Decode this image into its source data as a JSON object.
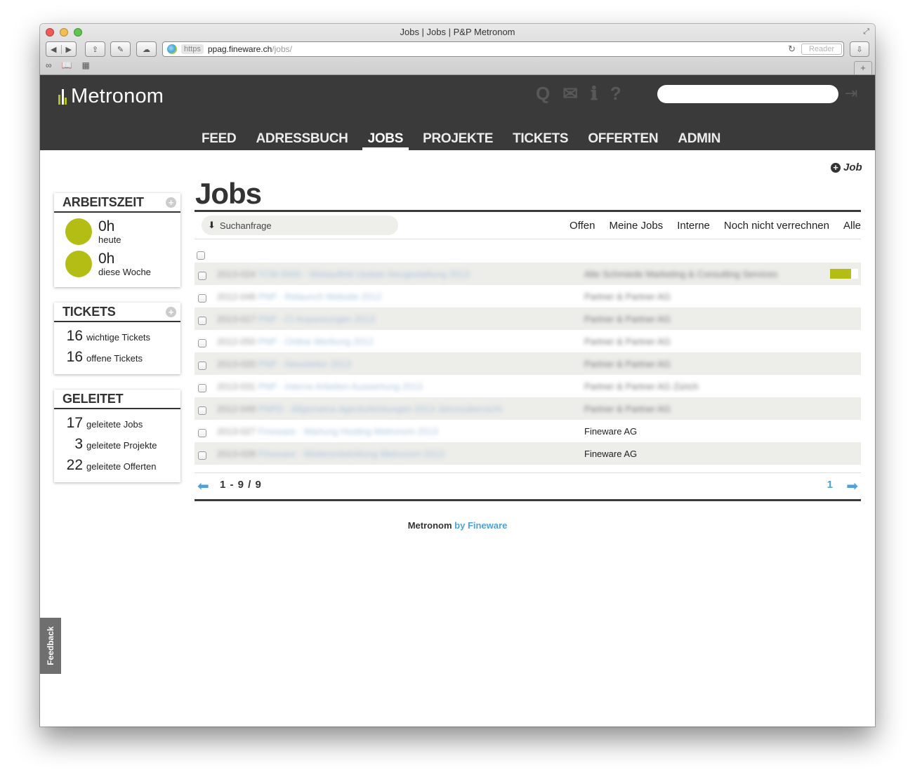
{
  "browser": {
    "title": "Jobs | Jobs | P&P Metronom",
    "url_scheme": "https",
    "url_host": "ppag.fineware.ch",
    "url_path": "/jobs/",
    "reader_label": "Reader",
    "nav_back_icon": "◀",
    "nav_forward_icon": "▶",
    "share_icon": "⇪",
    "tools_icon": "✎",
    "cloud_icon": "☁",
    "reload_icon": "↻",
    "download_icon": "⇩",
    "bookmark_icons": [
      "∞",
      "📖",
      "▦"
    ],
    "newtab_icon": "+"
  },
  "app": {
    "logo_text": "Metronom",
    "header_icons": [
      "Q",
      "✉",
      "ℹ",
      "?"
    ],
    "search_placeholder": "",
    "logout_icon": "⇥",
    "nav": [
      {
        "label": "FEED",
        "active": false
      },
      {
        "label": "ADRESSBUCH",
        "active": false
      },
      {
        "label": "JOBS",
        "active": true
      },
      {
        "label": "PROJEKTE",
        "active": false
      },
      {
        "label": "TICKETS",
        "active": false
      },
      {
        "label": "OFFERTEN",
        "active": false
      },
      {
        "label": "ADMIN",
        "active": false
      }
    ]
  },
  "sidebar": {
    "arbeitszeit": {
      "title": "ARBEITSZEIT",
      "plus": "+",
      "rows": [
        {
          "value": "0h",
          "label": "heute"
        },
        {
          "value": "0h",
          "label": "diese Woche"
        }
      ]
    },
    "tickets": {
      "title": "TICKETS",
      "plus": "+",
      "rows": [
        {
          "n": "16",
          "label": "wichtige Tickets"
        },
        {
          "n": "16",
          "label": "offene Tickets"
        }
      ]
    },
    "geleitet": {
      "title": "GELEITET",
      "rows": [
        {
          "n": "17",
          "label": "geleitete Jobs"
        },
        {
          "n": "3",
          "label": "geleitete Projekte"
        },
        {
          "n": "22",
          "label": "geleitete Offerten"
        }
      ]
    }
  },
  "main": {
    "new_job_icon": "+",
    "new_job_label": "Job",
    "title": "Jobs",
    "search_query_arrow": "⬇",
    "search_query_label": "Suchanfrage",
    "filters": [
      "Offen",
      "Meine Jobs",
      "Interne",
      "Noch nicht verrechnen",
      "Alle"
    ],
    "jobs": [
      {
        "id": "2013-024",
        "title": "TCM-0000 · Webauftritt Update Neugestaltung 2013",
        "client": "Alte Schmiede Marketing & Consulting Services",
        "client_blurred": true,
        "tag_color": "#b4bd13"
      },
      {
        "id": "2012-048",
        "title": "PNP · Relaunch Website 2012",
        "client": "Partner & Partner AG",
        "client_blurred": true,
        "tag_color": ""
      },
      {
        "id": "2013-017",
        "title": "PNP · CI Anpassungen 2013",
        "client": "Partner & Partner AG",
        "client_blurred": true,
        "tag_color": ""
      },
      {
        "id": "2012-050",
        "title": "PNP · Online Werbung 2012",
        "client": "Partner & Partner AG",
        "client_blurred": true,
        "tag_color": ""
      },
      {
        "id": "2013-020",
        "title": "PNP · Newsletter 2013",
        "client": "Partner & Partner AG",
        "client_blurred": true,
        "tag_color": ""
      },
      {
        "id": "2013-031",
        "title": "PNP · Interne Arbeiten Auswertung 2013",
        "client": "Partner & Partner AG Zürich",
        "client_blurred": true,
        "tag_color": ""
      },
      {
        "id": "2012-049",
        "title": "PNPD · Allgemeine Agenturleistungen 2013 Jahresübersicht",
        "client": "Partner & Partner AG",
        "client_blurred": true,
        "tag_color": ""
      },
      {
        "id": "2013-027",
        "title": "Fineware · Wartung Hosting Metronom 2013",
        "client": "Fineware AG",
        "client_blurred": false,
        "tag_color": ""
      },
      {
        "id": "2013-028",
        "title": "Fineware · Weiterentwicklung Metronom 2013",
        "client": "Fineware AG",
        "client_blurred": false,
        "tag_color": ""
      }
    ],
    "pager": {
      "prev_icon": "⬅",
      "range": "1 - 9 / 9",
      "page": "1",
      "next_icon": "➡"
    }
  },
  "footer": {
    "brand": "Metronom",
    "by": "by Fineware"
  },
  "feedback_label": "Feedback"
}
